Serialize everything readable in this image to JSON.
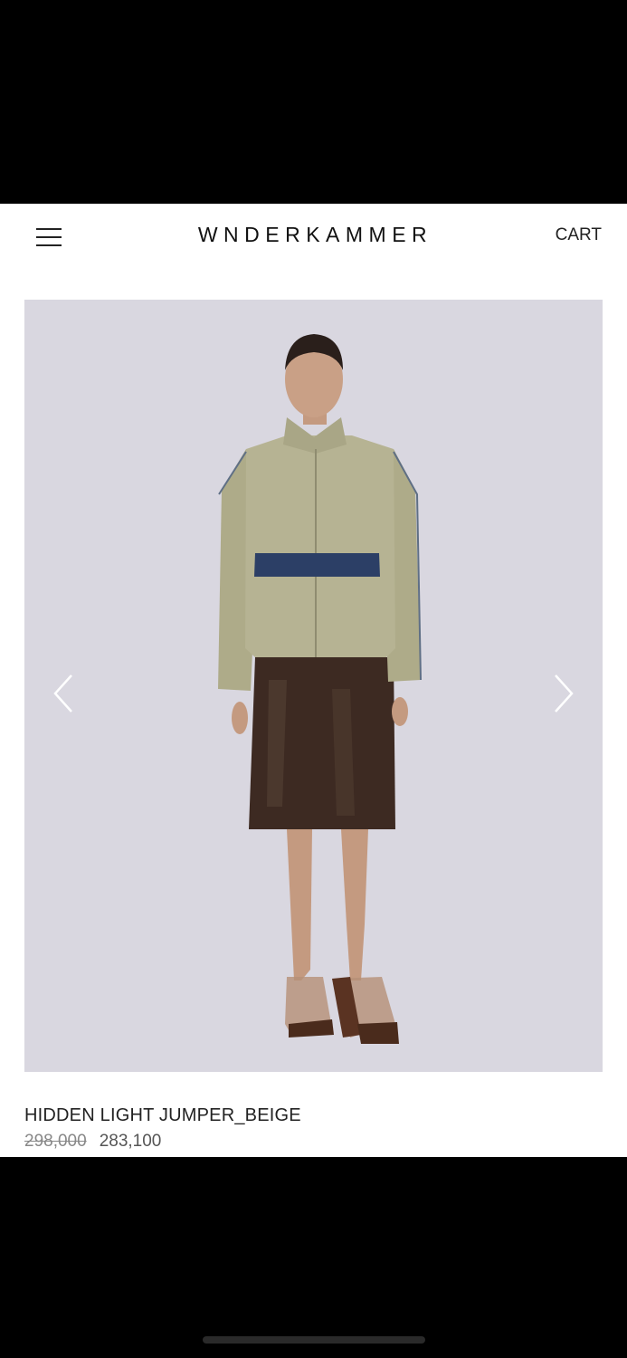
{
  "header": {
    "logo": "WNDERKAMMER",
    "cart_label": "CART",
    "menu_icon": "hamburger-menu-icon"
  },
  "gallery": {
    "prev_icon": "chevron-left-icon",
    "next_icon": "chevron-right-icon"
  },
  "product": {
    "name": "HIDDEN LIGHT JUMPER_BEIGE",
    "original_price": "298,000",
    "sale_price": "283,100"
  }
}
